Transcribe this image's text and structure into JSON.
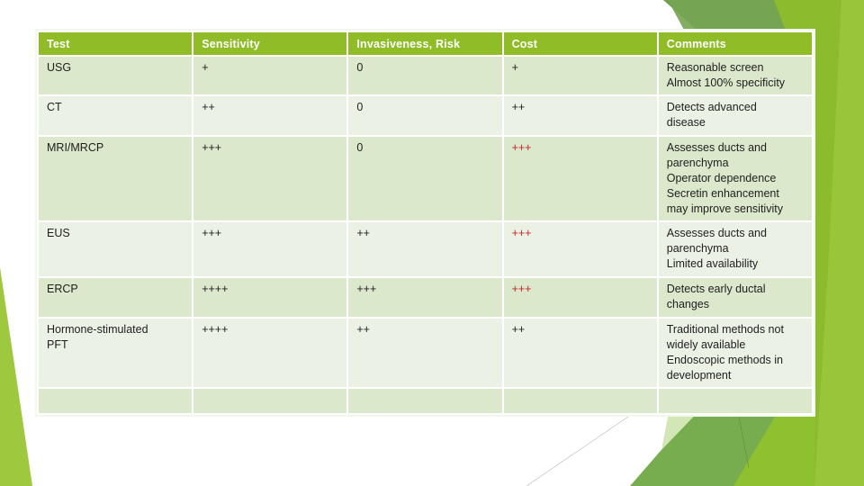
{
  "slide": {
    "colors": {
      "header_bg": "#8fbc27",
      "row_odd_bg": "#dbe8cc",
      "row_even_bg": "#ebf2e5",
      "highlight_text": "#c0282d",
      "accent_green_light": "#9bc53d",
      "accent_green_dark": "#6f9f4f"
    }
  },
  "table": {
    "headers": [
      "Test",
      "Sensitivity",
      "Invasiveness, Risk",
      "Cost",
      "Comments"
    ],
    "rows": [
      {
        "test": "USG",
        "sensitivity": "+",
        "invasiveness": "0",
        "cost": "+",
        "cost_highlight": false,
        "comments": "Reasonable screen\nAlmost 100% specificity"
      },
      {
        "test": "CT",
        "sensitivity": "++",
        "invasiveness": "0",
        "cost": "++",
        "cost_highlight": false,
        "comments": "Detects advanced\ndisease"
      },
      {
        "test": "MRI/MRCP",
        "sensitivity": "+++",
        "invasiveness": "0",
        "cost": "+++",
        "cost_highlight": true,
        "comments": "Assesses ducts and\nparenchyma\nOperator dependence\nSecretin enhancement\nmay improve sensitivity"
      },
      {
        "test": "EUS",
        "sensitivity": "+++",
        "invasiveness": "++",
        "cost": "+++",
        "cost_highlight": true,
        "comments": "Assesses ducts and\nparenchyma\nLimited availability"
      },
      {
        "test": "ERCP",
        "sensitivity": "++++",
        "invasiveness": "+++",
        "cost": "+++",
        "cost_highlight": true,
        "comments": "Detects early ductal\nchanges"
      },
      {
        "test": "Hormone-stimulated\nPFT",
        "sensitivity": "++++",
        "invasiveness": "++",
        "cost": "++",
        "cost_highlight": false,
        "comments": "Traditional methods not\nwidely available\nEndoscopic methods in\ndevelopment"
      },
      {
        "test": "",
        "sensitivity": "",
        "invasiveness": "",
        "cost": "",
        "cost_highlight": false,
        "comments": ""
      }
    ]
  }
}
